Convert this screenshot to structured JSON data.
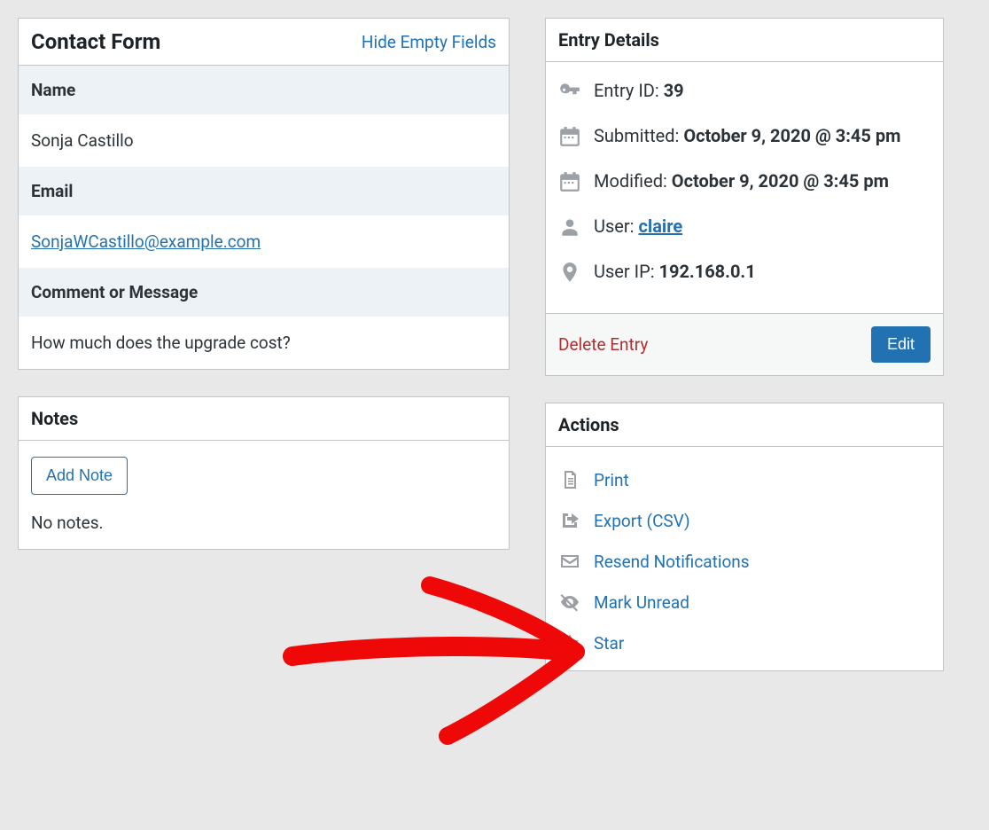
{
  "contactForm": {
    "title": "Contact Form",
    "hideEmptyLabel": "Hide Empty Fields",
    "nameLabel": "Name",
    "nameValue": "Sonja Castillo",
    "emailLabel": "Email",
    "emailValue": "SonjaWCastillo@example.com",
    "commentLabel": "Comment or Message",
    "commentValue": "How much does the upgrade cost?"
  },
  "notes": {
    "title": "Notes",
    "addNoteLabel": "Add Note",
    "noNotesText": "No notes."
  },
  "entryDetails": {
    "title": "Entry Details",
    "entryIdLabel": "Entry ID: ",
    "entryIdValue": "39",
    "submittedLabel": "Submitted: ",
    "submittedValue": "October 9, 2020 @ 3:45 pm",
    "modifiedLabel": "Modified: ",
    "modifiedValue": "October 9, 2020 @ 3:45 pm",
    "userLabel": "User: ",
    "userValue": "claire",
    "userIpLabel": "User IP: ",
    "userIpValue": "192.168.0.1",
    "deleteLabel": "Delete Entry",
    "editLabel": "Edit"
  },
  "actions": {
    "title": "Actions",
    "print": "Print",
    "export": "Export (CSV)",
    "resend": "Resend Notifications",
    "markUnread": "Mark Unread",
    "star": "Star"
  }
}
